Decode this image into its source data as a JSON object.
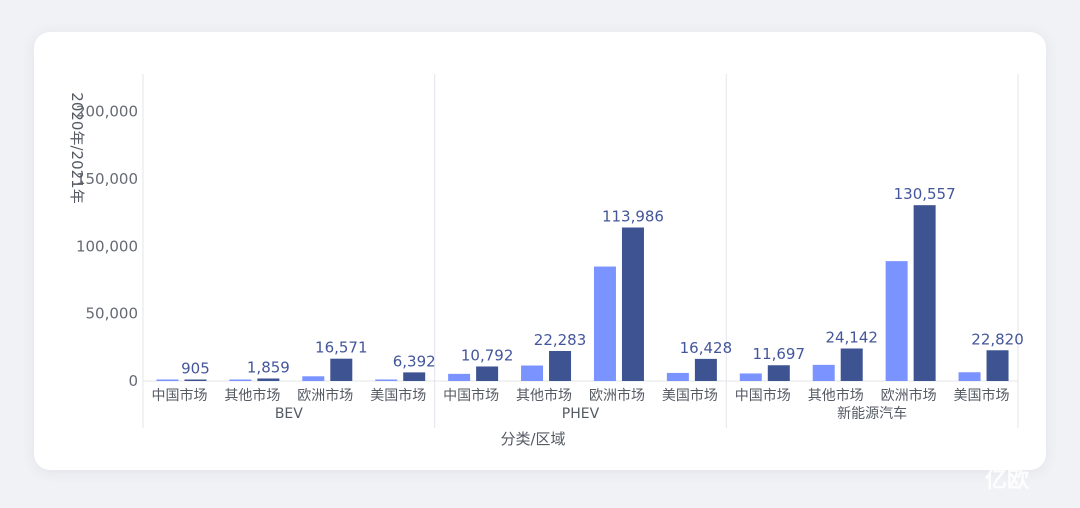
{
  "chart_data": {
    "type": "bar",
    "ylabel": "2020年/2021年",
    "xlabel": "分类/区域",
    "ylim": [
      0,
      225000
    ],
    "yticks": [
      0,
      50000,
      100000,
      150000,
      200000
    ],
    "ytick_labels": [
      "0",
      "50,000",
      "100,000",
      "150,000",
      "200,000"
    ],
    "grid": "vertical separators between groups",
    "colors": {
      "2020": "#7b93ff",
      "2021": "#3d5392"
    },
    "groups": [
      {
        "name": "BEV",
        "categories": [
          "中国市场",
          "其他市场",
          "欧洲市场",
          "美国市场"
        ],
        "values_2020": [
          400,
          800,
          3500,
          900
        ],
        "values_2021": [
          905,
          1859,
          16571,
          6392
        ],
        "labels_2021": [
          "905",
          "1,859",
          "16,571",
          "6,392"
        ]
      },
      {
        "name": "PHEV",
        "categories": [
          "中国市场",
          "其他市场",
          "欧洲市场",
          "美国市场"
        ],
        "values_2020": [
          5300,
          11500,
          85000,
          6000
        ],
        "values_2021": [
          10792,
          22283,
          113986,
          16428
        ],
        "labels_2021": [
          "10,792",
          "22,283",
          "113,986",
          "16,428"
        ]
      },
      {
        "name": "新能源汽车",
        "categories": [
          "中国市场",
          "其他市场",
          "欧洲市场",
          "美国市场"
        ],
        "values_2020": [
          5600,
          12000,
          89000,
          6500
        ],
        "values_2021": [
          11697,
          24142,
          130557,
          22820
        ],
        "labels_2021": [
          "11,697",
          "24,142",
          "130,557",
          "22,820"
        ]
      }
    ]
  },
  "watermark": "亿欧"
}
